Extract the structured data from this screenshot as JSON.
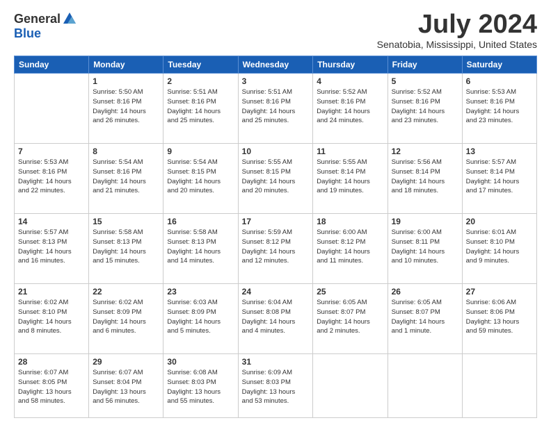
{
  "logo": {
    "general": "General",
    "blue": "Blue"
  },
  "title": "July 2024",
  "location": "Senatobia, Mississippi, United States",
  "days_header": [
    "Sunday",
    "Monday",
    "Tuesday",
    "Wednesday",
    "Thursday",
    "Friday",
    "Saturday"
  ],
  "weeks": [
    [
      {
        "day": "",
        "info": ""
      },
      {
        "day": "1",
        "info": "Sunrise: 5:50 AM\nSunset: 8:16 PM\nDaylight: 14 hours\nand 26 minutes."
      },
      {
        "day": "2",
        "info": "Sunrise: 5:51 AM\nSunset: 8:16 PM\nDaylight: 14 hours\nand 25 minutes."
      },
      {
        "day": "3",
        "info": "Sunrise: 5:51 AM\nSunset: 8:16 PM\nDaylight: 14 hours\nand 25 minutes."
      },
      {
        "day": "4",
        "info": "Sunrise: 5:52 AM\nSunset: 8:16 PM\nDaylight: 14 hours\nand 24 minutes."
      },
      {
        "day": "5",
        "info": "Sunrise: 5:52 AM\nSunset: 8:16 PM\nDaylight: 14 hours\nand 23 minutes."
      },
      {
        "day": "6",
        "info": "Sunrise: 5:53 AM\nSunset: 8:16 PM\nDaylight: 14 hours\nand 23 minutes."
      }
    ],
    [
      {
        "day": "7",
        "info": "Sunrise: 5:53 AM\nSunset: 8:16 PM\nDaylight: 14 hours\nand 22 minutes."
      },
      {
        "day": "8",
        "info": "Sunrise: 5:54 AM\nSunset: 8:16 PM\nDaylight: 14 hours\nand 21 minutes."
      },
      {
        "day": "9",
        "info": "Sunrise: 5:54 AM\nSunset: 8:15 PM\nDaylight: 14 hours\nand 20 minutes."
      },
      {
        "day": "10",
        "info": "Sunrise: 5:55 AM\nSunset: 8:15 PM\nDaylight: 14 hours\nand 20 minutes."
      },
      {
        "day": "11",
        "info": "Sunrise: 5:55 AM\nSunset: 8:14 PM\nDaylight: 14 hours\nand 19 minutes."
      },
      {
        "day": "12",
        "info": "Sunrise: 5:56 AM\nSunset: 8:14 PM\nDaylight: 14 hours\nand 18 minutes."
      },
      {
        "day": "13",
        "info": "Sunrise: 5:57 AM\nSunset: 8:14 PM\nDaylight: 14 hours\nand 17 minutes."
      }
    ],
    [
      {
        "day": "14",
        "info": "Sunrise: 5:57 AM\nSunset: 8:13 PM\nDaylight: 14 hours\nand 16 minutes."
      },
      {
        "day": "15",
        "info": "Sunrise: 5:58 AM\nSunset: 8:13 PM\nDaylight: 14 hours\nand 15 minutes."
      },
      {
        "day": "16",
        "info": "Sunrise: 5:58 AM\nSunset: 8:13 PM\nDaylight: 14 hours\nand 14 minutes."
      },
      {
        "day": "17",
        "info": "Sunrise: 5:59 AM\nSunset: 8:12 PM\nDaylight: 14 hours\nand 12 minutes."
      },
      {
        "day": "18",
        "info": "Sunrise: 6:00 AM\nSunset: 8:12 PM\nDaylight: 14 hours\nand 11 minutes."
      },
      {
        "day": "19",
        "info": "Sunrise: 6:00 AM\nSunset: 8:11 PM\nDaylight: 14 hours\nand 10 minutes."
      },
      {
        "day": "20",
        "info": "Sunrise: 6:01 AM\nSunset: 8:10 PM\nDaylight: 14 hours\nand 9 minutes."
      }
    ],
    [
      {
        "day": "21",
        "info": "Sunrise: 6:02 AM\nSunset: 8:10 PM\nDaylight: 14 hours\nand 8 minutes."
      },
      {
        "day": "22",
        "info": "Sunrise: 6:02 AM\nSunset: 8:09 PM\nDaylight: 14 hours\nand 6 minutes."
      },
      {
        "day": "23",
        "info": "Sunrise: 6:03 AM\nSunset: 8:09 PM\nDaylight: 14 hours\nand 5 minutes."
      },
      {
        "day": "24",
        "info": "Sunrise: 6:04 AM\nSunset: 8:08 PM\nDaylight: 14 hours\nand 4 minutes."
      },
      {
        "day": "25",
        "info": "Sunrise: 6:05 AM\nSunset: 8:07 PM\nDaylight: 14 hours\nand 2 minutes."
      },
      {
        "day": "26",
        "info": "Sunrise: 6:05 AM\nSunset: 8:07 PM\nDaylight: 14 hours\nand 1 minute."
      },
      {
        "day": "27",
        "info": "Sunrise: 6:06 AM\nSunset: 8:06 PM\nDaylight: 13 hours\nand 59 minutes."
      }
    ],
    [
      {
        "day": "28",
        "info": "Sunrise: 6:07 AM\nSunset: 8:05 PM\nDaylight: 13 hours\nand 58 minutes."
      },
      {
        "day": "29",
        "info": "Sunrise: 6:07 AM\nSunset: 8:04 PM\nDaylight: 13 hours\nand 56 minutes."
      },
      {
        "day": "30",
        "info": "Sunrise: 6:08 AM\nSunset: 8:03 PM\nDaylight: 13 hours\nand 55 minutes."
      },
      {
        "day": "31",
        "info": "Sunrise: 6:09 AM\nSunset: 8:03 PM\nDaylight: 13 hours\nand 53 minutes."
      },
      {
        "day": "",
        "info": ""
      },
      {
        "day": "",
        "info": ""
      },
      {
        "day": "",
        "info": ""
      }
    ]
  ]
}
